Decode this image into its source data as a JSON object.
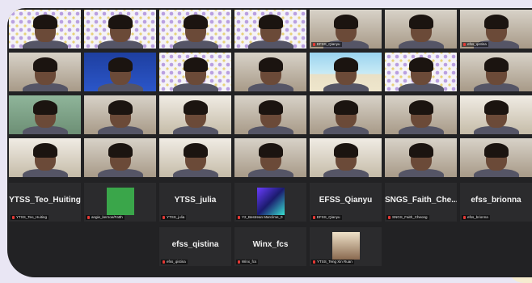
{
  "rows": [
    [
      {
        "name": "",
        "bg": "pattern"
      },
      {
        "name": "",
        "bg": "pattern"
      },
      {
        "name": "",
        "bg": "pattern"
      },
      {
        "name": "",
        "bg": "pattern"
      },
      {
        "name": "EFSS_Qianyu",
        "bg": "room"
      },
      {
        "name": "",
        "bg": "room"
      },
      {
        "name": "efss_qistina",
        "bg": "room"
      }
    ],
    [
      {
        "name": "",
        "bg": "room"
      },
      {
        "name": "",
        "bg": "blue"
      },
      {
        "name": "",
        "bg": "pattern"
      },
      {
        "name": "",
        "bg": "room"
      },
      {
        "name": "",
        "bg": "beach"
      },
      {
        "name": "",
        "bg": "pattern"
      },
      {
        "name": "",
        "bg": "room"
      }
    ],
    [
      {
        "name": "",
        "bg": "greenwall"
      },
      {
        "name": "",
        "bg": "room"
      },
      {
        "name": "",
        "bg": "classroom"
      },
      {
        "name": "",
        "bg": "room"
      },
      {
        "name": "",
        "bg": "room"
      },
      {
        "name": "",
        "bg": "room"
      },
      {
        "name": "",
        "bg": "classroom"
      }
    ],
    [
      {
        "name": "",
        "bg": "classroom"
      },
      {
        "name": "",
        "bg": "room"
      },
      {
        "name": "",
        "bg": "classroom"
      },
      {
        "name": "",
        "bg": "room"
      },
      {
        "name": "",
        "bg": "classroom"
      },
      {
        "name": "",
        "bg": "room"
      },
      {
        "name": "",
        "bg": "room"
      }
    ]
  ],
  "row5": [
    {
      "big": "YTSS_Teo_Huiting",
      "tag": "YTSS_Teo_Huiting",
      "type": "text"
    },
    {
      "big": "",
      "tag": "angie_kernoe/Fatth",
      "type": "green"
    },
    {
      "big": "YTSS_julia",
      "tag": "YTSS_julia",
      "type": "text"
    },
    {
      "big": "",
      "tag": "Y2_Bestrean Marcilme_0",
      "type": "img"
    },
    {
      "big": "EFSS_Qianyu",
      "tag": "EFSS_Qianyu",
      "type": "text"
    },
    {
      "big": "SNGS_Faith_Che...",
      "tag": "SNGS_Faith_Cheong",
      "type": "text"
    },
    {
      "big": "efss_brionna",
      "tag": "efss_brionna",
      "type": "text"
    }
  ],
  "row6": [
    {
      "big": "efss_qistina",
      "tag": "efss_qistina",
      "type": "text"
    },
    {
      "big": "Winx_fcs",
      "tag": "Winx_fcs",
      "type": "text"
    },
    {
      "big": "",
      "tag": "YTSS_Teng Xin Ruan",
      "type": "img"
    }
  ]
}
